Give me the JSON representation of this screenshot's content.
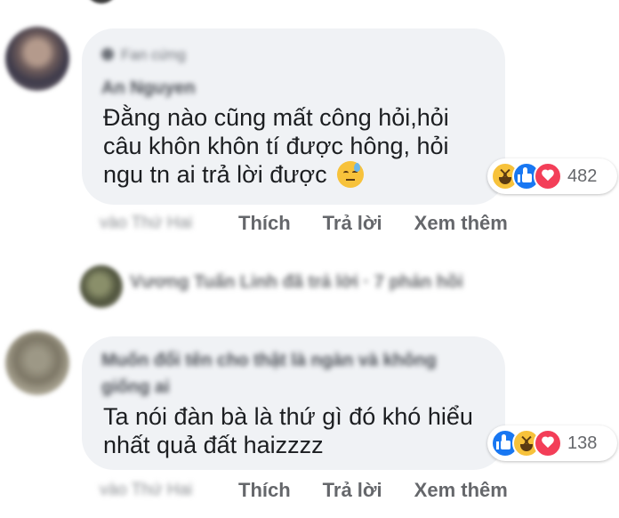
{
  "comments": [
    {
      "group_label": "Fan cứng",
      "author": "An Nguyen",
      "text_lines": [
        "Đằng nào cũng mất công hỏi,hỏi",
        "câu khôn khôn tí được hông, hỏi",
        "ngu tn ai trả lời được"
      ],
      "reaction_count": "482",
      "timestamp": "vào Thứ Hai",
      "actions": {
        "like": "Thích",
        "reply": "Trả lời",
        "more": "Xem thêm"
      }
    },
    {
      "reply_summary": "Vương Tuấn Linh đã trả lời · 7 phản hồi"
    },
    {
      "author": "Muốn đổi tên cho thật là ngàn và không giống ai",
      "text_lines": [
        "Ta nói đàn bà là thứ gì đó khó hiểu",
        "nhất quả đất haizzzz"
      ],
      "reaction_count": "138",
      "timestamp": "vào Thứ Hai",
      "actions": {
        "like": "Thích",
        "reply": "Trả lời",
        "more": "Xem thêm"
      }
    }
  ],
  "colors": {
    "bubble": "#f0f2f5",
    "text": "#1c1e21",
    "secondary": "#65676b",
    "like": "#1877f2",
    "love": "#f33e58",
    "haha": "#f7c23b"
  },
  "icons": {
    "comment_1_emoji": "downcast-face-with-sweat-icon",
    "comment_1_reactions": [
      "haha-icon",
      "like-icon",
      "love-icon"
    ],
    "comment_3_reactions": [
      "like-icon",
      "haha-icon",
      "love-icon"
    ]
  }
}
